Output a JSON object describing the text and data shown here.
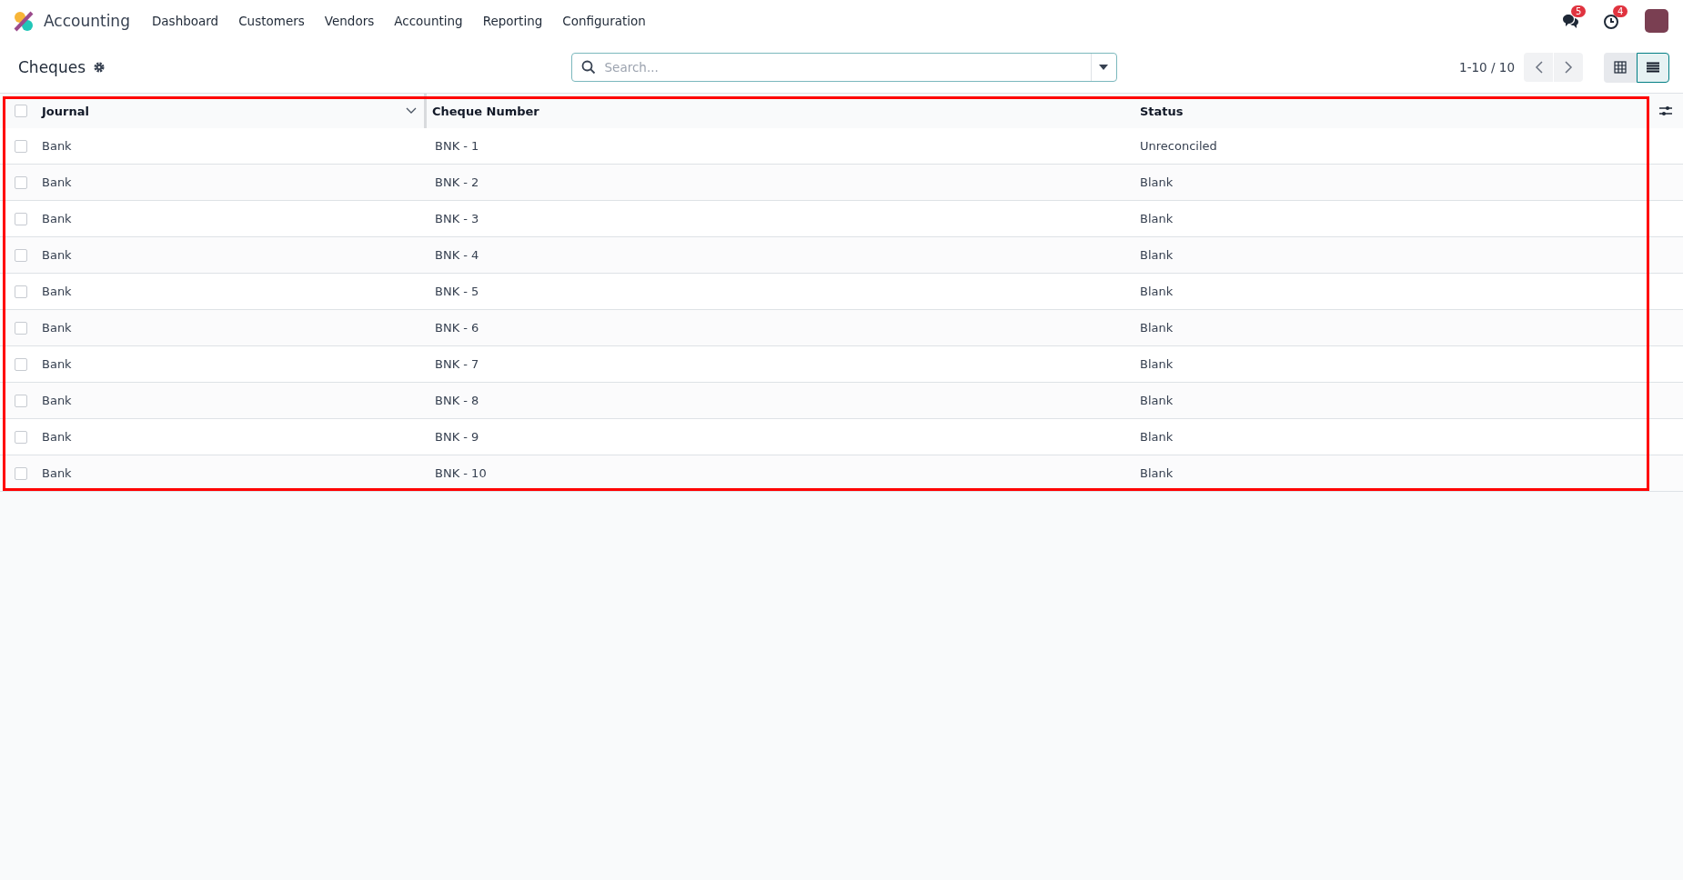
{
  "navbar": {
    "app_name": "Accounting",
    "menu": [
      "Dashboard",
      "Customers",
      "Vendors",
      "Accounting",
      "Reporting",
      "Configuration"
    ],
    "notifications": [
      {
        "kind": "chat",
        "count": "5"
      },
      {
        "kind": "activity",
        "count": "4"
      }
    ]
  },
  "control_panel": {
    "title": "Cheques",
    "search": {
      "placeholder": "Search..."
    },
    "pager": "1-10 / 10",
    "views": [
      {
        "kind": "grid",
        "selected": false
      },
      {
        "kind": "list",
        "selected": true
      }
    ]
  },
  "table": {
    "all_checked": false,
    "columns": [
      "Journal",
      "Cheque Number",
      "Status"
    ],
    "rows": [
      {
        "checked": false,
        "cells": [
          "Bank",
          "BNK - 1",
          "Unreconciled"
        ]
      },
      {
        "checked": false,
        "cells": [
          "Bank",
          "BNK - 2",
          "Blank"
        ]
      },
      {
        "checked": false,
        "cells": [
          "Bank",
          "BNK - 3",
          "Blank"
        ]
      },
      {
        "checked": false,
        "cells": [
          "Bank",
          "BNK - 4",
          "Blank"
        ]
      },
      {
        "checked": false,
        "cells": [
          "Bank",
          "BNK - 5",
          "Blank"
        ]
      },
      {
        "checked": false,
        "cells": [
          "Bank",
          "BNK - 6",
          "Blank"
        ]
      },
      {
        "checked": false,
        "cells": [
          "Bank",
          "BNK - 7",
          "Blank"
        ]
      },
      {
        "checked": false,
        "cells": [
          "Bank",
          "BNK - 8",
          "Blank"
        ]
      },
      {
        "checked": false,
        "cells": [
          "Bank",
          "BNK - 9",
          "Blank"
        ]
      },
      {
        "checked": false,
        "cells": [
          "Bank",
          "BNK - 10",
          "Blank"
        ]
      }
    ]
  }
}
